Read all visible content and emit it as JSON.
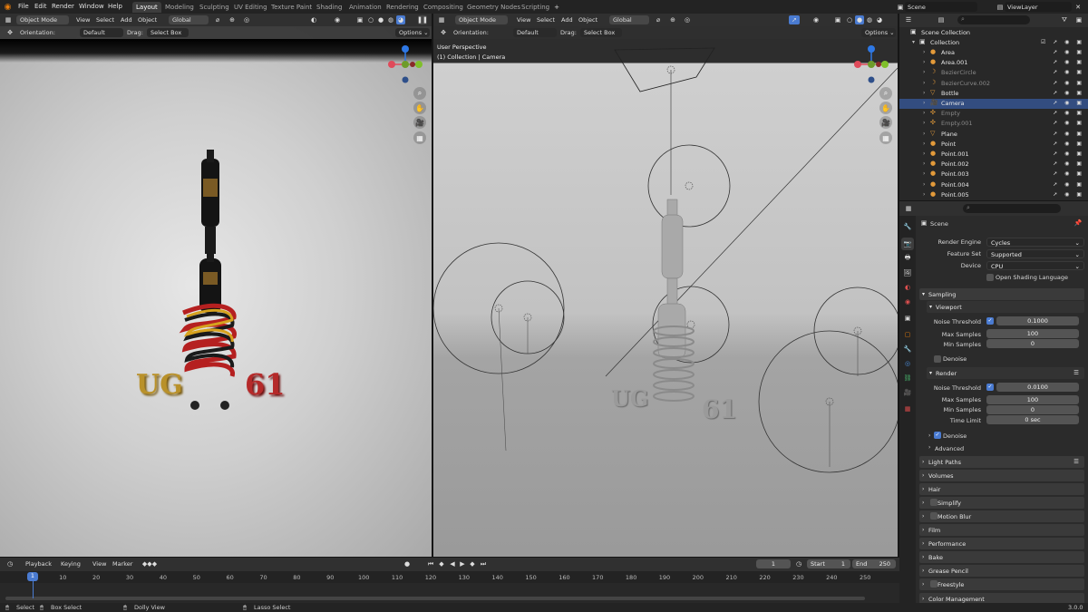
{
  "topbar": {
    "menus": [
      "File",
      "Edit",
      "Render",
      "Window",
      "Help"
    ],
    "workspaces": [
      "Layout",
      "Modeling",
      "Sculpting",
      "UV Editing",
      "Texture Paint",
      "Shading",
      "Animation",
      "Rendering",
      "Compositing",
      "Geometry Nodes",
      "Scripting"
    ],
    "scene": "Scene",
    "view_layer": "ViewLayer"
  },
  "viewport_left": {
    "mode": "Object Mode",
    "menus": [
      "View",
      "Select",
      "Add",
      "Object"
    ],
    "transform": "Global",
    "orientation_label": "Orientation:",
    "orientation_value": "Default",
    "drag_label": "Drag:",
    "drag_value": "Select Box",
    "options": "Options",
    "text_left": "UG",
    "text_right": "61"
  },
  "viewport_right": {
    "mode": "Object Mode",
    "menus": [
      "View",
      "Select",
      "Add",
      "Object"
    ],
    "transform": "Global",
    "orientation_label": "Orientation:",
    "orientation_value": "Default",
    "drag_label": "Drag:",
    "drag_value": "Select Box",
    "options": "Options",
    "overlay_line1": "User Perspective",
    "overlay_line2": "(1) Collection | Camera",
    "text_left": "UG",
    "text_right": "61"
  },
  "gizmo": {
    "x": "X",
    "y": "Y",
    "z": "Z"
  },
  "outliner": {
    "root": "Scene Collection",
    "collection": "Collection",
    "items": [
      {
        "name": "Area",
        "icon": "light-icon",
        "color": "#e39a3a",
        "dim": false,
        "selected": false
      },
      {
        "name": "Area.001",
        "icon": "light-icon",
        "color": "#e39a3a",
        "dim": false,
        "selected": false
      },
      {
        "name": "BezierCircle",
        "icon": "curve-icon",
        "color": "#e39a3a",
        "dim": true,
        "selected": false
      },
      {
        "name": "BezierCurve.002",
        "icon": "curve-icon",
        "color": "#e39a3a",
        "dim": true,
        "selected": false
      },
      {
        "name": "Bottle",
        "icon": "mesh-icon",
        "color": "#e39a3a",
        "dim": false,
        "selected": false
      },
      {
        "name": "Camera",
        "icon": "camera-icon",
        "color": "#e39a3a",
        "dim": false,
        "selected": true
      },
      {
        "name": "Empty",
        "icon": "empty-icon",
        "color": "#e39a3a",
        "dim": true,
        "selected": false
      },
      {
        "name": "Empty.001",
        "icon": "empty-icon",
        "color": "#e39a3a",
        "dim": true,
        "selected": false
      },
      {
        "name": "Plane",
        "icon": "mesh-icon",
        "color": "#e39a3a",
        "dim": false,
        "selected": false
      },
      {
        "name": "Point",
        "icon": "light-icon",
        "color": "#e39a3a",
        "dim": false,
        "selected": false
      },
      {
        "name": "Point.001",
        "icon": "light-icon",
        "color": "#e39a3a",
        "dim": false,
        "selected": false
      },
      {
        "name": "Point.002",
        "icon": "light-icon",
        "color": "#e39a3a",
        "dim": false,
        "selected": false
      },
      {
        "name": "Point.003",
        "icon": "light-icon",
        "color": "#e39a3a",
        "dim": false,
        "selected": false
      },
      {
        "name": "Point.004",
        "icon": "light-icon",
        "color": "#e39a3a",
        "dim": false,
        "selected": false
      },
      {
        "name": "Point.005",
        "icon": "light-icon",
        "color": "#e39a3a",
        "dim": false,
        "selected": false
      }
    ]
  },
  "properties": {
    "context": "Scene",
    "render_engine_label": "Render Engine",
    "render_engine": "Cycles",
    "feature_set_label": "Feature Set",
    "feature_set": "Supported",
    "device_label": "Device",
    "device": "CPU",
    "osl_label": "Open Shading Language",
    "sampling": "Sampling",
    "viewport": "Viewport",
    "noise_threshold_label": "Noise Threshold",
    "vp_noise_threshold": "0.1000",
    "max_samples_label": "Max Samples",
    "vp_max_samples": "100",
    "min_samples_label": "Min Samples",
    "vp_min_samples": "0",
    "denoise_label": "Denoise",
    "render": "Render",
    "r_noise_threshold": "0.0100",
    "r_max_samples": "100",
    "r_min_samples": "0",
    "time_limit_label": "Time Limit",
    "r_time_limit": "0 sec",
    "advanced": "Advanced",
    "panels": [
      "Light Paths",
      "Volumes",
      "Hair",
      "Simplify",
      "Motion Blur",
      "Film",
      "Performance",
      "Bake",
      "Grease Pencil",
      "Freestyle",
      "Color Management"
    ]
  },
  "timeline": {
    "menus": [
      "Playback",
      "Keying",
      "View",
      "Marker"
    ],
    "current_frame": "1",
    "start_label": "Start",
    "start": "1",
    "end_label": "End",
    "end": "250",
    "ticks": [
      "1",
      "10",
      "20",
      "30",
      "40",
      "50",
      "60",
      "70",
      "80",
      "90",
      "100",
      "110",
      "120",
      "130",
      "140",
      "150",
      "160",
      "170",
      "180",
      "190",
      "200",
      "210",
      "220",
      "230",
      "240",
      "250"
    ],
    "playhead_frame": 1
  },
  "statusbar": {
    "select": "Select",
    "box_select": "Box Select",
    "dolly_view": "Dolly View",
    "lasso_select": "Lasso Select",
    "version": "3.0.0"
  }
}
